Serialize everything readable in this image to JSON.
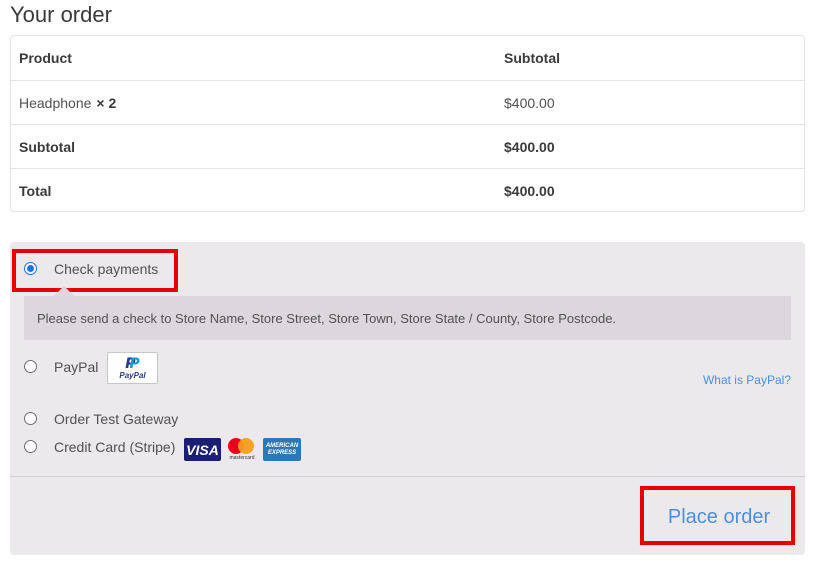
{
  "heading": "Your order",
  "order_table": {
    "headers": {
      "product": "Product",
      "subtotal": "Subtotal"
    },
    "item": {
      "name": "Headphone",
      "qty": "× 2",
      "price": "$400.00"
    },
    "subtotal": {
      "label": "Subtotal",
      "value": "$400.00"
    },
    "total": {
      "label": "Total",
      "value": "$400.00"
    }
  },
  "payment": {
    "methods": [
      {
        "label": "Check payments",
        "selected": true
      },
      {
        "label": "PayPal",
        "selected": false
      },
      {
        "label": "Order Test Gateway",
        "selected": false
      },
      {
        "label": "Credit Card (Stripe)",
        "selected": false
      }
    ],
    "check_description": "Please send a check to Store Name, Store Street, Store Town, Store State / County, Store Postcode.",
    "paypal_badge_text": "PayPal",
    "what_is_paypal": "What is PayPal?",
    "cards": {
      "visa": "VISA",
      "mastercard": "mastercard",
      "amex_line1": "AMERICAN",
      "amex_line2": "EXPRESS"
    },
    "icons": [
      "paypal-logo-icon",
      "visa-card-icon",
      "mastercard-icon",
      "amex-card-icon"
    ]
  },
  "place_order_label": "Place order",
  "colors": {
    "accent": "#4a90e2",
    "highlight": "#e60000",
    "payment_bg": "#ebe9eb"
  }
}
